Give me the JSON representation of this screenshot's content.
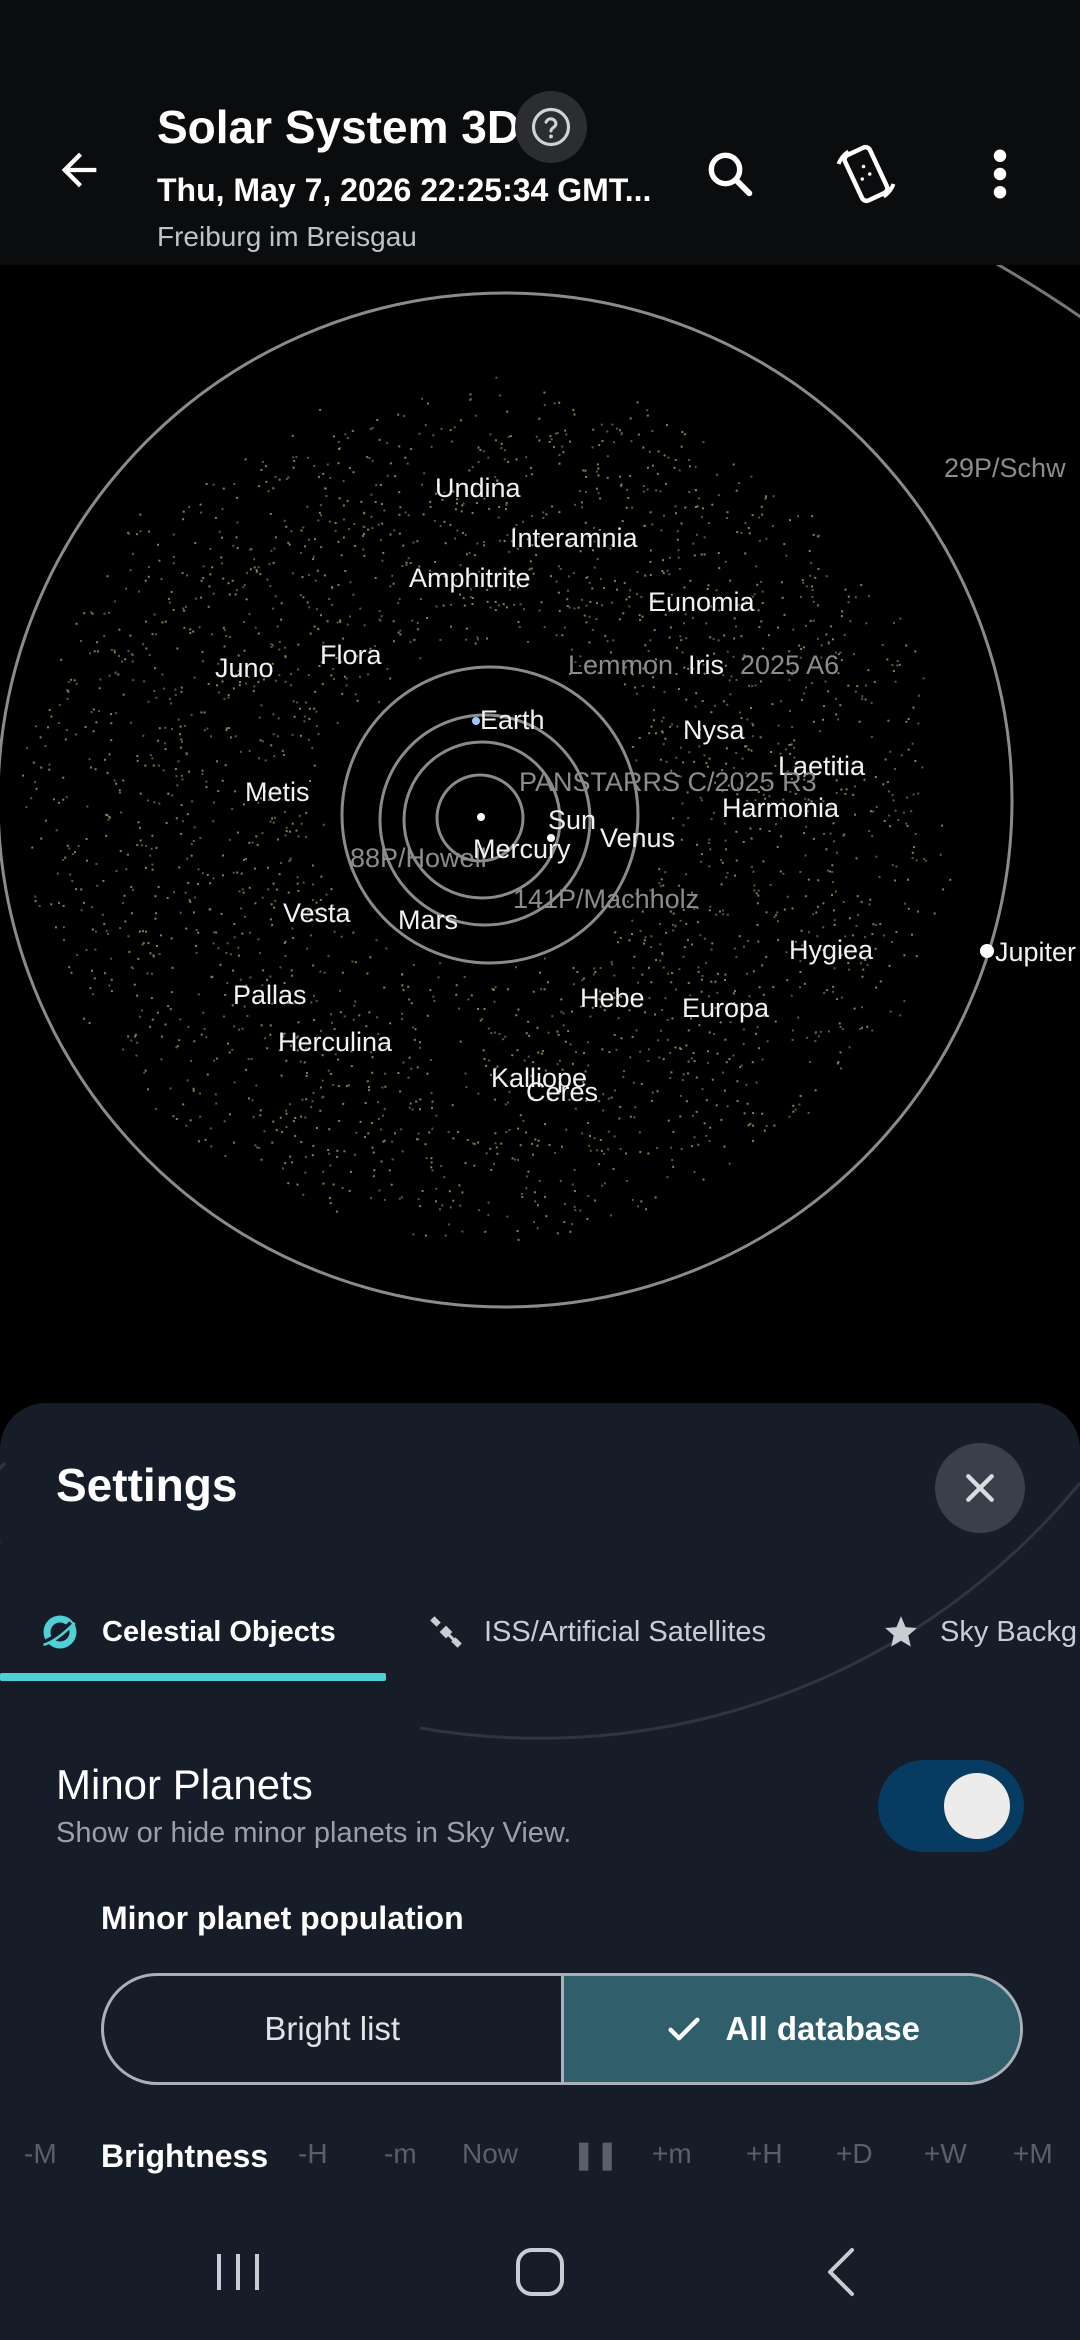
{
  "appbar": {
    "title": "Solar System 3D",
    "datetime": "Thu, May 7, 2026 22:25:34 GMT...",
    "location": "Freiburg im Breisgau",
    "icons": [
      "back-arrow-icon",
      "help-icon",
      "search-icon",
      "device-rotate-icon",
      "more-vert-icon"
    ]
  },
  "sky": {
    "objects": [
      {
        "name": "Undina",
        "dim": false
      },
      {
        "name": "Interamnia",
        "dim": false
      },
      {
        "name": "Amphitrite",
        "dim": false
      },
      {
        "name": "Eunomia",
        "dim": false
      },
      {
        "name": "Juno",
        "dim": false
      },
      {
        "name": "Flora",
        "dim": false
      },
      {
        "name": "Lemmon",
        "dim": true
      },
      {
        "name": "Iris",
        "dim": false
      },
      {
        "name": "2025 A6",
        "dim": true
      },
      {
        "name": "Earth",
        "dim": false
      },
      {
        "name": "Nysa",
        "dim": false
      },
      {
        "name": "Laetitia",
        "dim": false
      },
      {
        "name": "Metis",
        "dim": false
      },
      {
        "name": "PANSTARRS C/2025 R3",
        "dim": true
      },
      {
        "name": "Harmonia",
        "dim": false
      },
      {
        "name": "Sun",
        "dim": false
      },
      {
        "name": "Venus",
        "dim": false
      },
      {
        "name": "88P/Howell",
        "dim": true
      },
      {
        "name": "Mercury",
        "dim": false
      },
      {
        "name": "141P/Machholz",
        "dim": true
      },
      {
        "name": "Vesta",
        "dim": false
      },
      {
        "name": "Mars",
        "dim": false
      },
      {
        "name": "Hygiea",
        "dim": false
      },
      {
        "name": "Jupiter",
        "dim": false
      },
      {
        "name": "Pallas",
        "dim": false
      },
      {
        "name": "Hebe",
        "dim": false
      },
      {
        "name": "Europa",
        "dim": false
      },
      {
        "name": "Herculina",
        "dim": false
      },
      {
        "name": "Kalliope",
        "dim": false
      },
      {
        "name": "Ceres",
        "dim": false
      },
      {
        "name": "29P/Schw",
        "dim": true
      }
    ]
  },
  "settings": {
    "title": "Settings",
    "tabs": [
      {
        "label": "Celestial Objects",
        "active": true,
        "icon": "planet-icon"
      },
      {
        "label": "ISS/Artificial Satellites",
        "active": false,
        "icon": "satellite-icon"
      },
      {
        "label": "Sky Backg",
        "active": false,
        "icon": "star-icon"
      }
    ],
    "minor_planets": {
      "title": "Minor Planets",
      "description": "Show or hide minor planets in Sky View.",
      "enabled": true
    },
    "population": {
      "label": "Minor planet population",
      "options": [
        "Bright list",
        "All database"
      ],
      "selected": "All database"
    },
    "brightness_label": "Brightness",
    "time_controls": [
      "-M",
      "-H",
      "-m",
      "Now",
      "+m",
      "+H",
      "+D",
      "+W",
      "+M"
    ]
  },
  "colors": {
    "accent": "#4fd0d6",
    "toggle_on": "#073b62",
    "segment_selected": "#305e6a",
    "sheet_bg": "#161c28"
  }
}
